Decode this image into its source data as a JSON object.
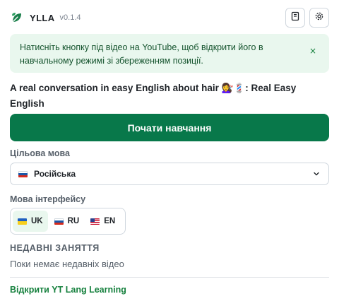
{
  "header": {
    "app_name": "YLLA",
    "version": "v0.1.4",
    "logo_icon": "leaf-icon",
    "actions": [
      {
        "icon": "notebook-icon"
      },
      {
        "icon": "gear-icon"
      }
    ]
  },
  "banner": {
    "text": "Натисніть кнопку під відео на YouTube, щоб відкрити його в навчальному режимі зі збереженням позиції.",
    "close_label": "×"
  },
  "video": {
    "title": "A real conversation in easy English about hair 💇‍♀️💈: Real Easy English"
  },
  "start_button": {
    "label": "Почати навчання"
  },
  "target_language": {
    "label": "Цільова мова",
    "selected": "Російська",
    "selected_flag": "flag-ru-icon"
  },
  "interface_language": {
    "label": "Мова інтерфейсу",
    "options": [
      {
        "code": "UK",
        "flag": "flag-ua-icon",
        "active": true
      },
      {
        "code": "RU",
        "flag": "flag-ru-icon",
        "active": false
      },
      {
        "code": "EN",
        "flag": "flag-us-icon",
        "active": false
      }
    ]
  },
  "recent": {
    "heading": "НЕДАВНІ ЗАНЯТТЯ",
    "empty_text": "Поки немає недавніх відео"
  },
  "footer": {
    "link_label": "Відкрити YT Lang Learning"
  },
  "colors": {
    "primary": "#08784a",
    "banner_bg": "#e9f7ee",
    "link": "#15803d"
  }
}
